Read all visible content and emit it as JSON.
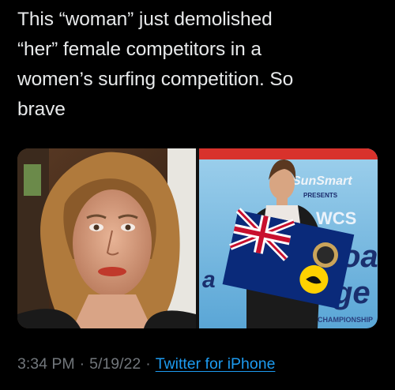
{
  "tweet": {
    "text_lines": [
      "This “woman” just demolished",
      "“her” female competitors in a",
      "women’s surfing competition. So",
      "brave"
    ],
    "media": {
      "left_photo": "person-selfie-photo",
      "right_photo": "surfer-holding-flag-photo",
      "banner_texts": [
        "SunSmart",
        "PRESENTS",
        "WCS",
        "oa",
        "ge",
        "CHAMPIONSHIP",
        "a"
      ]
    },
    "time": "3:34 PM",
    "date": "5/19/22",
    "separator": "·",
    "source": "Twitter for iPhone"
  },
  "colors": {
    "background": "#000000",
    "text": "#e7e9ea",
    "meta": "#71767b",
    "link": "#1d9bf0"
  }
}
